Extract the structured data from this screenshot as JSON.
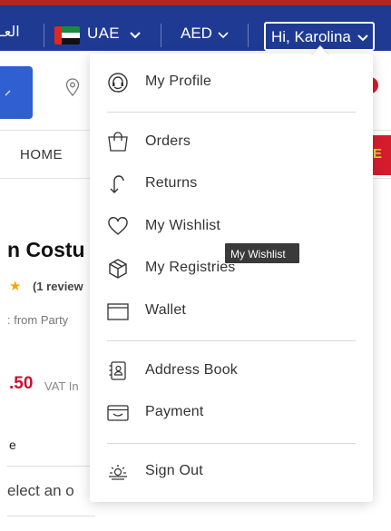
{
  "header": {
    "language_link": "العـ",
    "country": "UAE",
    "currency": "AED",
    "user_greeting": "Hi, Karolina"
  },
  "page": {
    "nav_home": "HOME",
    "promo_letter": "E",
    "product_title": "n Costu",
    "rating_star": "★",
    "reviews": "(1 review",
    "from_text": ": from  Party",
    "price": ".50",
    "vat": "VAT In",
    "size_label": "e",
    "select_placeholder": "elect an o"
  },
  "menu": {
    "profile": "My Profile",
    "orders": "Orders",
    "returns": "Returns",
    "wishlist": "My Wishlist",
    "registries": "My Registries",
    "wallet": "Wallet",
    "address_book": "Address Book",
    "payment": "Payment",
    "sign_out": "Sign Out"
  },
  "tooltip": "My Wishlist",
  "colors": {
    "header_blue": "#1f3a93",
    "accent_red": "#c8102e",
    "top_strip": "#b3261e"
  },
  "icons": [
    "headset-icon",
    "shopping-bag-icon",
    "return-arrow-icon",
    "heart-icon",
    "gift-box-icon",
    "wallet-icon",
    "address-book-icon",
    "credit-card-icon",
    "sign-out-sun-icon",
    "location-pin-icon",
    "chevron-down-icon",
    "uae-flag-icon"
  ]
}
